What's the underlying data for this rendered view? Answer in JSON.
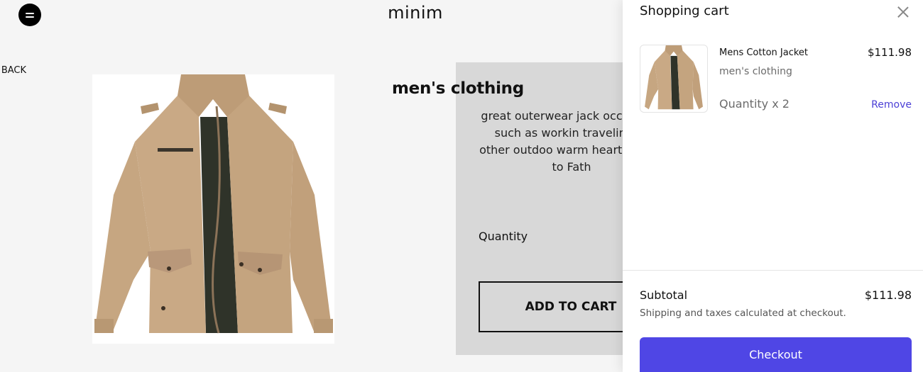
{
  "header": {
    "brand": "minim"
  },
  "nav": {
    "back_label": "BACK",
    "back_icon": "chevron-left-icon"
  },
  "product": {
    "category": "men's clothing",
    "description": "great outerwear jack occasions, such as workin traveling or other outdoo warm hearted love to Fath",
    "quantity_label": "Quantity",
    "add_to_cart_label": "ADD TO CART"
  },
  "cart": {
    "title": "Shopping cart",
    "items": [
      {
        "name": "Mens Cotton Jacket",
        "category": "men's clothing",
        "quantity": "Quantity x 2",
        "price": "$111.98",
        "remove_label": "Remove"
      }
    ],
    "subtotal_label": "Subtotal",
    "subtotal_value": "$111.98",
    "shipping_note": "Shipping and taxes calculated at checkout.",
    "checkout_label": "Checkout"
  },
  "colors": {
    "accent": "#4f46e5",
    "jacket": "#c8a883",
    "panel": "#d8d8d8",
    "page_bg": "#f5f5f5"
  }
}
